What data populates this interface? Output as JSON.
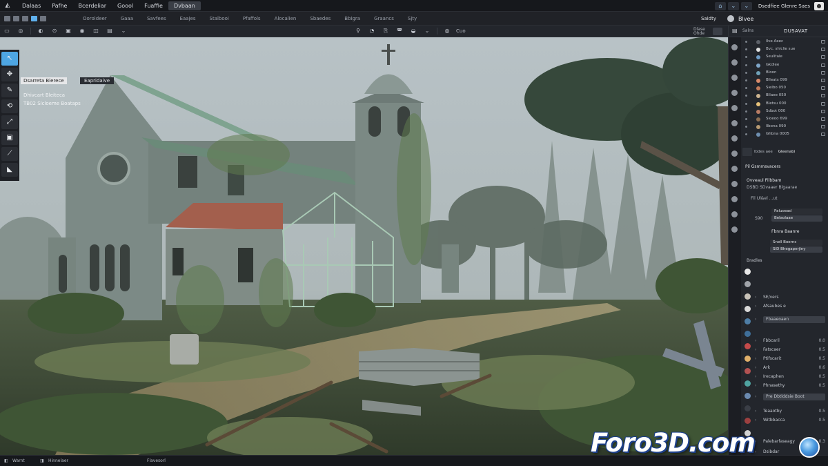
{
  "menubar": {
    "items": [
      "Dalaas",
      "Pafhe",
      "Bcerdeliar",
      "Goool",
      "Fuaffie",
      "Dvbaan"
    ],
    "active_index": 5,
    "title": "Dsedfiee Glenre Saes"
  },
  "tabrow": {
    "tabs": [
      "Ooroldeer",
      "Gaaa",
      "Savfees",
      "Eaajes",
      "Stalbooi",
      "Pfaffols",
      "Alocalien",
      "Sbaedes",
      "Bbigra",
      "Graancs",
      "Sjty"
    ],
    "right_label": "Saidty",
    "right_label2": "Blvee"
  },
  "toolbar": {
    "shading_label": "Cuo",
    "right_text": "Dlase Ohde"
  },
  "viewport": {
    "tag1": "Dsarreta Bierece",
    "tag2": "Eapridaive",
    "info_line1": "Dhivcart Bleiteca",
    "info_line2": "TB02 Slcloeme Boataps"
  },
  "panel": {
    "head_label": "Salns",
    "head_title": "DUSAVAT",
    "outliner_rows": [
      {
        "label": "Ilve Aeec",
        "color": "#5c6068"
      },
      {
        "label": "Bvc. shlclie sue",
        "color": "#e0e0e0"
      },
      {
        "label": "Seulitale",
        "color": "#6e9bc4"
      },
      {
        "label": "Gkdlee",
        "color": "#7fa6c8"
      },
      {
        "label": "Bloon",
        "color": "#6fa1b8"
      },
      {
        "label": "Blleats 099",
        "color": "#d98a6a"
      },
      {
        "label": "Sielbo 050",
        "color": "#c07a5a"
      },
      {
        "label": "Bllaee 050",
        "color": "#cdb490"
      },
      {
        "label": "Bletsu 000",
        "color": "#e6c17a"
      },
      {
        "label": "Sdbot 000",
        "color": "#b97c64"
      },
      {
        "label": "Sloeoo 699",
        "color": "#8a6d52"
      },
      {
        "label": "Ilbona 090",
        "color": "#b79a72"
      },
      {
        "label": "Ghbna 0005",
        "color": "#6f8fb0"
      }
    ],
    "props_tabs": [
      "Ibdes aee",
      "Gleenabi"
    ],
    "props": {
      "section": "Pil Gsmmsvacers",
      "line1": "Ovveaul Pilbbam",
      "line2": "DSBD SDvaaer Blgaarae",
      "line3": "Fll Ul&el ...ut",
      "field1_label": "Paluoead",
      "field2_label": "S90",
      "field2": "Belaolaae",
      "line4": "Fbnra Baanre",
      "field3": "Snell Boerns",
      "field4": "SID Bhegaperjiny"
    },
    "materials": {
      "head": "Bradles",
      "rows": [
        {
          "label": "SE/vers",
          "value": ""
        },
        {
          "label": "Afsaubes e",
          "value": ""
        },
        {
          "label": "Fbaaeoaen",
          "value": "",
          "selected": true
        },
        {
          "label": "Fbbcaril",
          "value": "0.0"
        },
        {
          "label": "Fatscaer",
          "value": "0.5"
        },
        {
          "label": "Ptifscarit",
          "value": "0.5"
        },
        {
          "label": "Ark",
          "value": "0.6"
        },
        {
          "label": "Irecaphen",
          "value": "0.5"
        },
        {
          "label": "Phnasethy",
          "value": "0.5"
        },
        {
          "label": "Pre Dbtlddsie Boot",
          "value": "",
          "selected": true
        },
        {
          "label": "Teaaotby",
          "value": "0.5"
        },
        {
          "label": "Witbbacca",
          "value": "0.5"
        },
        {
          "label": "Palebarfaseagy",
          "value": "0.3"
        },
        {
          "label": "Dsibdar",
          "value": ""
        },
        {
          "label": "Oilnbtagg",
          "value": ""
        }
      ],
      "ball_colors": [
        "#e7e7e7",
        "#a0a4aa",
        "#c8c2b8",
        "#d9d9d9",
        "#4e7ea6",
        "#3f6f9a",
        "#c44a4a",
        "#e0b06a",
        "#b35252",
        "#4fa3a0",
        "#6b8ab0",
        "#3a3e46",
        "#9c4040",
        "#d2d2d2"
      ]
    }
  },
  "statusbar": {
    "left": "Warnt",
    "mid": "Hinnelaer",
    "center": "Flavesorl"
  },
  "watermark": "Foro3D.com"
}
